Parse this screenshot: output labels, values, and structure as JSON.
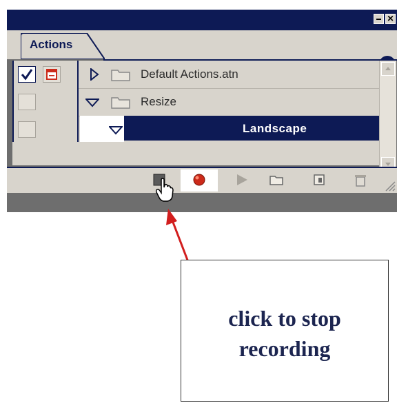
{
  "palette": {
    "tab_label": "Actions",
    "title_buttons": [
      "minimize",
      "close"
    ],
    "rows": [
      {
        "label": "Default Actions.atn",
        "type": "set",
        "expanded": false,
        "checked": true,
        "dialog_toggle": true,
        "icon": "folder-icon"
      },
      {
        "label": "Resize",
        "type": "set",
        "expanded": true,
        "checked": false,
        "dialog_toggle": false,
        "icon": "folder-icon"
      },
      {
        "label": "Landscape",
        "type": "action",
        "expanded": true,
        "checked": false,
        "dialog_toggle": false,
        "selected": true
      }
    ],
    "toolbar": [
      "stop-icon",
      "record-icon",
      "play-icon",
      "folder-icon",
      "new-action-icon",
      "trash-icon"
    ],
    "colors": {
      "titlebar": "#0d1a55",
      "panel": "#d8d4cc",
      "selection": "#0d1a55",
      "record": "#cc2a1a"
    }
  },
  "annotation": {
    "text_line1": "click to stop",
    "text_line2": "recording",
    "arrow_color": "#d21e1e"
  }
}
